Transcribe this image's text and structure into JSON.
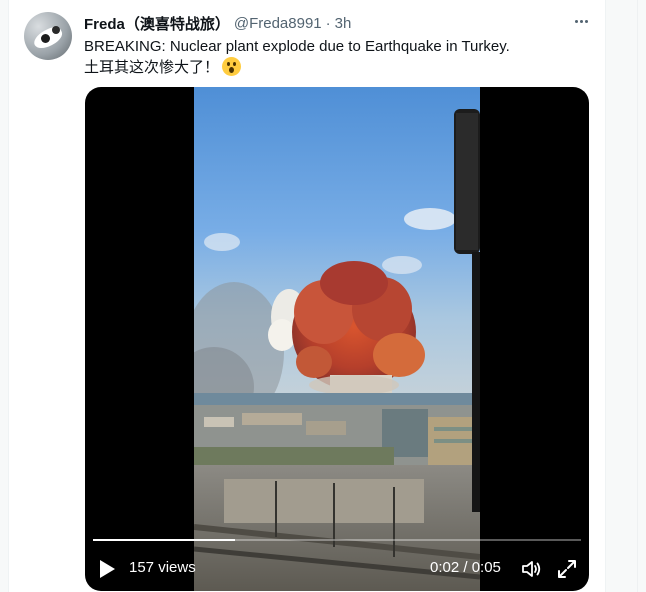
{
  "tweet": {
    "display_name": "Freda（澳喜特战旅）",
    "handle": "@Freda8991",
    "separator": "·",
    "time": "3h",
    "text_line1": "BREAKING: Nuclear plant explode due to Earthquake in Turkey.",
    "text_line2": "土耳其这次惨大了！"
  },
  "video": {
    "views": "157 views",
    "timecode": "0:02 / 0:05",
    "progress": 0.29
  },
  "icons": {
    "avatar": "cat-avatar",
    "more": "more-icon",
    "emoji": "fearful-face-emoji",
    "play": "play-icon",
    "volume": "volume-icon",
    "fullscreen": "fullscreen-icon"
  },
  "colors": {
    "text": "#0f1419",
    "secondary": "#536471",
    "video_bg": "#000000"
  }
}
